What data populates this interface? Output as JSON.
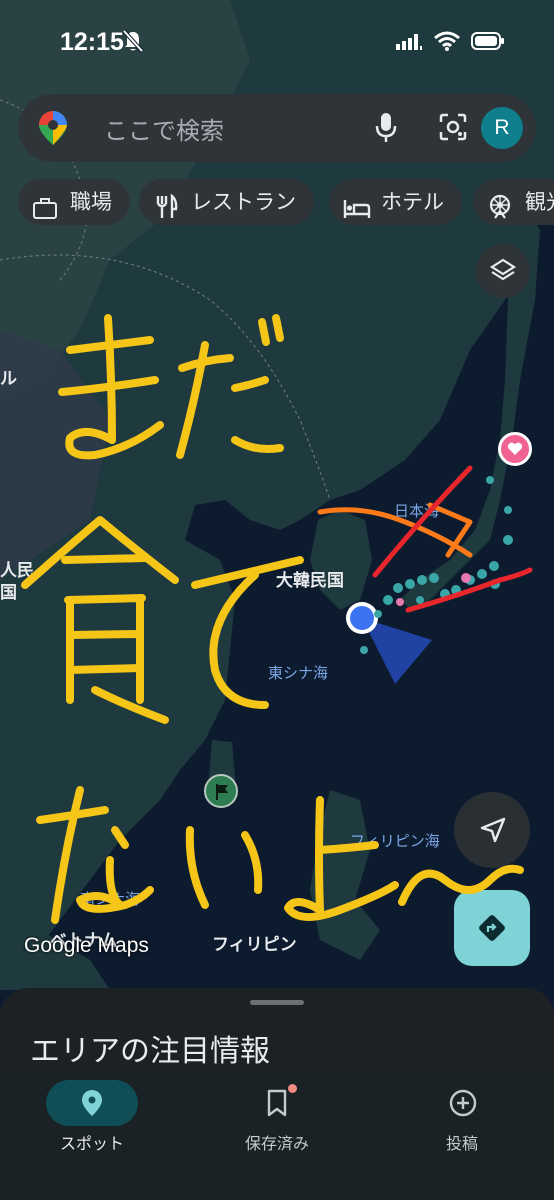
{
  "status_bar": {
    "time": "12:15"
  },
  "search": {
    "placeholder": "ここで検索",
    "avatar_letter": "R"
  },
  "chips": [
    {
      "label": "職場",
      "icon": "briefcase-icon"
    },
    {
      "label": "レストラン",
      "icon": "restaurant-icon"
    },
    {
      "label": "ホテル",
      "icon": "hotel-icon"
    },
    {
      "label": "観光",
      "icon": "attraction-icon"
    }
  ],
  "map": {
    "labels": {
      "korea": "大韓民国",
      "east_china_sea": "東シナ海",
      "sea_of_japan": "日本海",
      "philippine_sea": "フィリピン海",
      "philippines": "フィリピン",
      "south_china_sea": "南シナ海",
      "vietnam": "ベトナム",
      "partial_left_1": "ル",
      "partial_left_2": "人民",
      "partial_left_3": "国"
    },
    "logo": "Google Maps"
  },
  "handwriting": {
    "text": "まだ食べてないよ〜",
    "color": "#f5c518"
  },
  "sheet": {
    "title": "エリアの注目情報"
  },
  "tabs": [
    {
      "label": "スポット",
      "icon": "location-pin-icon",
      "active": true
    },
    {
      "label": "保存済み",
      "icon": "bookmark-icon",
      "active": false
    },
    {
      "label": "投稿",
      "icon": "add-circle-icon",
      "active": false
    }
  ]
}
